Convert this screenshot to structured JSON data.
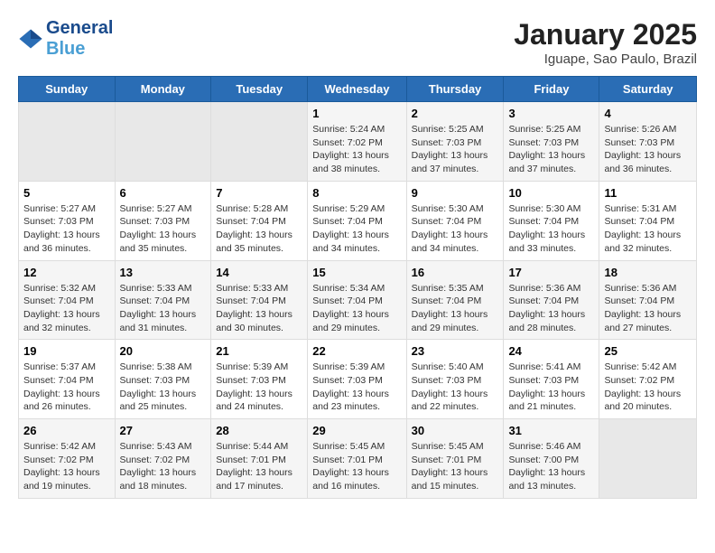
{
  "header": {
    "logo_general": "General",
    "logo_blue": "Blue",
    "month": "January 2025",
    "location": "Iguape, Sao Paulo, Brazil"
  },
  "days_of_week": [
    "Sunday",
    "Monday",
    "Tuesday",
    "Wednesday",
    "Thursday",
    "Friday",
    "Saturday"
  ],
  "weeks": [
    [
      {
        "day": null,
        "info": null
      },
      {
        "day": null,
        "info": null
      },
      {
        "day": null,
        "info": null
      },
      {
        "day": "1",
        "info": "Sunrise: 5:24 AM\nSunset: 7:02 PM\nDaylight: 13 hours\nand 38 minutes."
      },
      {
        "day": "2",
        "info": "Sunrise: 5:25 AM\nSunset: 7:03 PM\nDaylight: 13 hours\nand 37 minutes."
      },
      {
        "day": "3",
        "info": "Sunrise: 5:25 AM\nSunset: 7:03 PM\nDaylight: 13 hours\nand 37 minutes."
      },
      {
        "day": "4",
        "info": "Sunrise: 5:26 AM\nSunset: 7:03 PM\nDaylight: 13 hours\nand 36 minutes."
      }
    ],
    [
      {
        "day": "5",
        "info": "Sunrise: 5:27 AM\nSunset: 7:03 PM\nDaylight: 13 hours\nand 36 minutes."
      },
      {
        "day": "6",
        "info": "Sunrise: 5:27 AM\nSunset: 7:03 PM\nDaylight: 13 hours\nand 35 minutes."
      },
      {
        "day": "7",
        "info": "Sunrise: 5:28 AM\nSunset: 7:04 PM\nDaylight: 13 hours\nand 35 minutes."
      },
      {
        "day": "8",
        "info": "Sunrise: 5:29 AM\nSunset: 7:04 PM\nDaylight: 13 hours\nand 34 minutes."
      },
      {
        "day": "9",
        "info": "Sunrise: 5:30 AM\nSunset: 7:04 PM\nDaylight: 13 hours\nand 34 minutes."
      },
      {
        "day": "10",
        "info": "Sunrise: 5:30 AM\nSunset: 7:04 PM\nDaylight: 13 hours\nand 33 minutes."
      },
      {
        "day": "11",
        "info": "Sunrise: 5:31 AM\nSunset: 7:04 PM\nDaylight: 13 hours\nand 32 minutes."
      }
    ],
    [
      {
        "day": "12",
        "info": "Sunrise: 5:32 AM\nSunset: 7:04 PM\nDaylight: 13 hours\nand 32 minutes."
      },
      {
        "day": "13",
        "info": "Sunrise: 5:33 AM\nSunset: 7:04 PM\nDaylight: 13 hours\nand 31 minutes."
      },
      {
        "day": "14",
        "info": "Sunrise: 5:33 AM\nSunset: 7:04 PM\nDaylight: 13 hours\nand 30 minutes."
      },
      {
        "day": "15",
        "info": "Sunrise: 5:34 AM\nSunset: 7:04 PM\nDaylight: 13 hours\nand 29 minutes."
      },
      {
        "day": "16",
        "info": "Sunrise: 5:35 AM\nSunset: 7:04 PM\nDaylight: 13 hours\nand 29 minutes."
      },
      {
        "day": "17",
        "info": "Sunrise: 5:36 AM\nSunset: 7:04 PM\nDaylight: 13 hours\nand 28 minutes."
      },
      {
        "day": "18",
        "info": "Sunrise: 5:36 AM\nSunset: 7:04 PM\nDaylight: 13 hours\nand 27 minutes."
      }
    ],
    [
      {
        "day": "19",
        "info": "Sunrise: 5:37 AM\nSunset: 7:04 PM\nDaylight: 13 hours\nand 26 minutes."
      },
      {
        "day": "20",
        "info": "Sunrise: 5:38 AM\nSunset: 7:03 PM\nDaylight: 13 hours\nand 25 minutes."
      },
      {
        "day": "21",
        "info": "Sunrise: 5:39 AM\nSunset: 7:03 PM\nDaylight: 13 hours\nand 24 minutes."
      },
      {
        "day": "22",
        "info": "Sunrise: 5:39 AM\nSunset: 7:03 PM\nDaylight: 13 hours\nand 23 minutes."
      },
      {
        "day": "23",
        "info": "Sunrise: 5:40 AM\nSunset: 7:03 PM\nDaylight: 13 hours\nand 22 minutes."
      },
      {
        "day": "24",
        "info": "Sunrise: 5:41 AM\nSunset: 7:03 PM\nDaylight: 13 hours\nand 21 minutes."
      },
      {
        "day": "25",
        "info": "Sunrise: 5:42 AM\nSunset: 7:02 PM\nDaylight: 13 hours\nand 20 minutes."
      }
    ],
    [
      {
        "day": "26",
        "info": "Sunrise: 5:42 AM\nSunset: 7:02 PM\nDaylight: 13 hours\nand 19 minutes."
      },
      {
        "day": "27",
        "info": "Sunrise: 5:43 AM\nSunset: 7:02 PM\nDaylight: 13 hours\nand 18 minutes."
      },
      {
        "day": "28",
        "info": "Sunrise: 5:44 AM\nSunset: 7:01 PM\nDaylight: 13 hours\nand 17 minutes."
      },
      {
        "day": "29",
        "info": "Sunrise: 5:45 AM\nSunset: 7:01 PM\nDaylight: 13 hours\nand 16 minutes."
      },
      {
        "day": "30",
        "info": "Sunrise: 5:45 AM\nSunset: 7:01 PM\nDaylight: 13 hours\nand 15 minutes."
      },
      {
        "day": "31",
        "info": "Sunrise: 5:46 AM\nSunset: 7:00 PM\nDaylight: 13 hours\nand 13 minutes."
      },
      {
        "day": null,
        "info": null
      }
    ]
  ]
}
